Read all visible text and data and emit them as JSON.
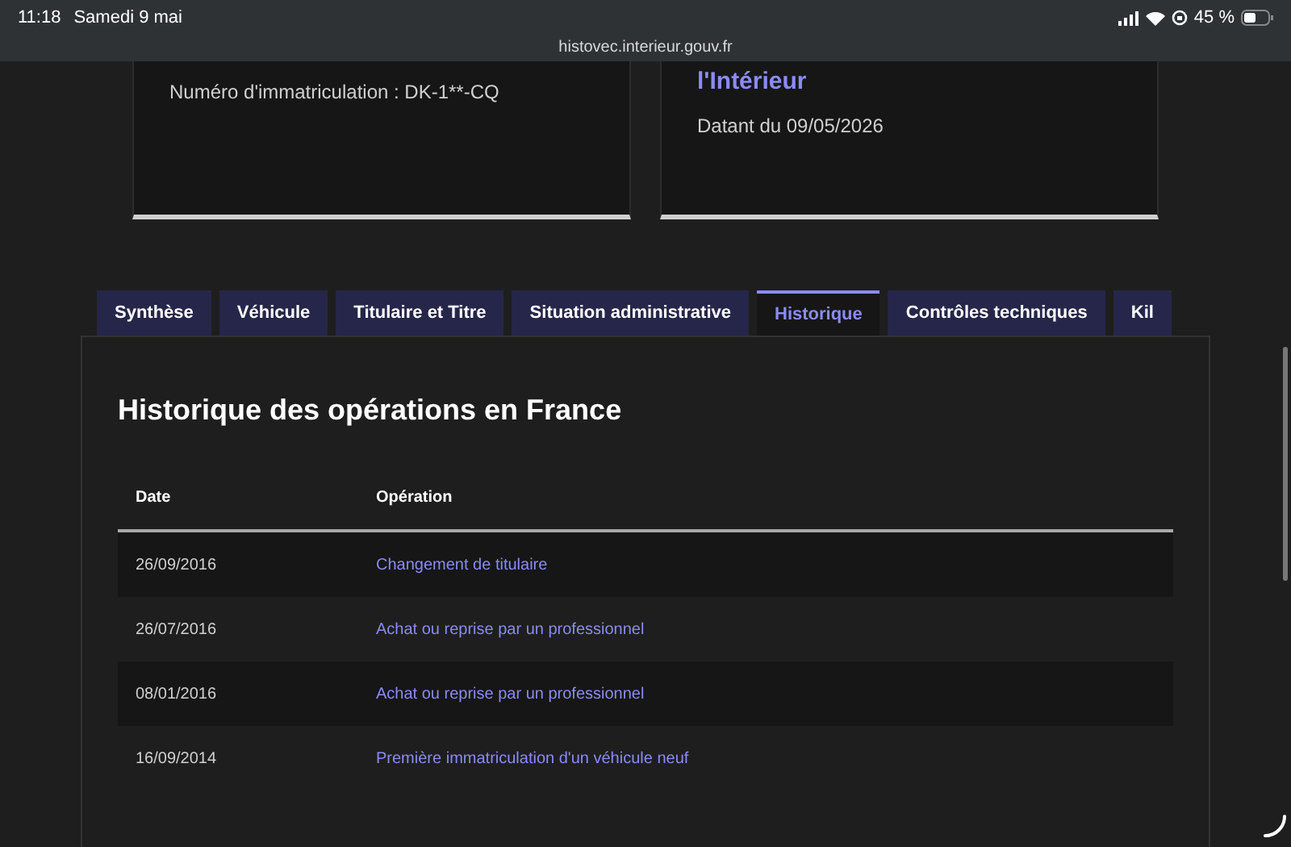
{
  "status_bar": {
    "time": "11:18",
    "date": "Samedi 9 mai",
    "battery": "45 %",
    "url": "histovec.interieur.gouv.fr"
  },
  "cards": [
    {
      "text": "Numéro d'immatriculation : DK-1**-CQ"
    },
    {
      "title": "l'Intérieur",
      "text": "Datant du 09/05/2026"
    }
  ],
  "tabs": [
    {
      "label": "Synthèse",
      "selected": false
    },
    {
      "label": "Véhicule",
      "selected": false
    },
    {
      "label": "Titulaire et Titre",
      "selected": false
    },
    {
      "label": "Situation administrative",
      "selected": false
    },
    {
      "label": "Historique",
      "selected": true
    },
    {
      "label": "Contrôles techniques",
      "selected": false
    },
    {
      "label": "Kil",
      "selected": false
    }
  ],
  "section": {
    "title": "Historique des opérations en France"
  },
  "table": {
    "columns": [
      "Date",
      "Opération"
    ],
    "rows": [
      {
        "date": "26/09/2016",
        "operation": "Changement de titulaire"
      },
      {
        "date": "26/07/2016",
        "operation": "Achat ou reprise par un professionnel"
      },
      {
        "date": "08/01/2016",
        "operation": "Achat ou reprise par un professionnel"
      },
      {
        "date": "16/09/2014",
        "operation": "Première immatriculation d'un véhicule neuf"
      }
    ]
  }
}
